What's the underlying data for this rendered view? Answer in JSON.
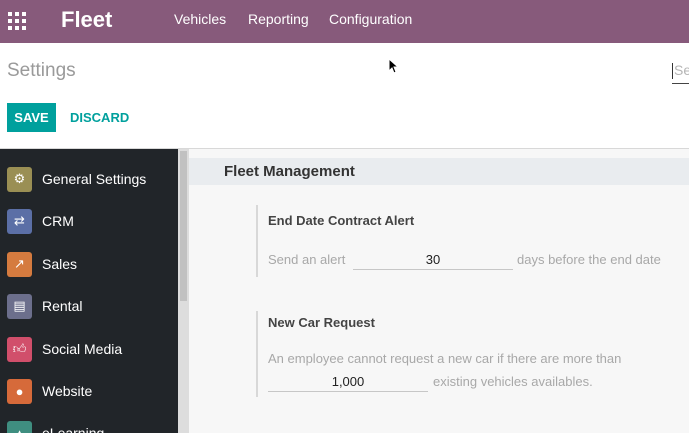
{
  "navbar": {
    "brand": "Fleet",
    "menu": [
      "Vehicles",
      "Reporting",
      "Configuration"
    ],
    "bg_color": "#875a7b"
  },
  "control_panel": {
    "breadcrumb": "Settings",
    "search_placeholder": "Se",
    "save_label": "SAVE",
    "discard_label": "DISCARD",
    "accent_color": "#00a09d"
  },
  "sidebar": {
    "items": [
      {
        "label": "General Settings",
        "icon": "gear-icon",
        "color": "#9a8f54"
      },
      {
        "label": "CRM",
        "icon": "handshake-icon",
        "color": "#5b6fa6"
      },
      {
        "label": "Sales",
        "icon": "chart-icon",
        "color": "#d57b3f"
      },
      {
        "label": "Rental",
        "icon": "rental-icon",
        "color": "#6c6f8c"
      },
      {
        "label": "Social Media",
        "icon": "thumbs-up-icon",
        "color": "#d14f6b"
      },
      {
        "label": "Website",
        "icon": "globe-icon",
        "color": "#d66a3a"
      },
      {
        "label": "eLearning",
        "icon": "learning-icon",
        "color": "#3f8e80"
      }
    ]
  },
  "main": {
    "section_title": "Fleet Management",
    "contract_alert": {
      "title": "End Date Contract Alert",
      "prefix": "Send an alert",
      "value": "30",
      "suffix": "days before the end date"
    },
    "new_car_request": {
      "title": "New Car Request",
      "description": "An employee cannot request a new car if there are more than",
      "value": "1,000",
      "suffix": "existing vehicles availables."
    }
  }
}
